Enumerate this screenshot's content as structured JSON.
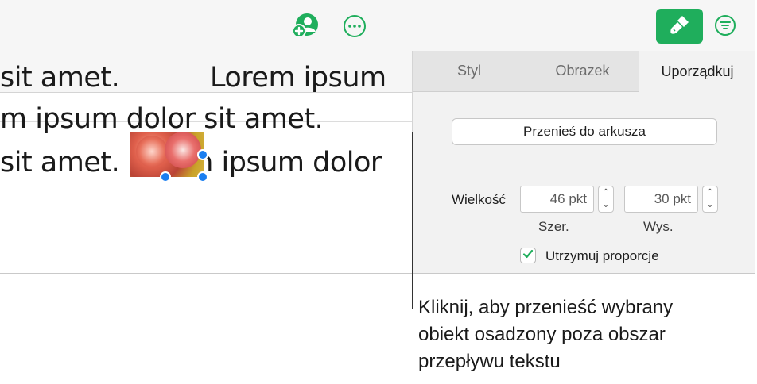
{
  "toolbar": {
    "collaborate_icon": "person-add-icon",
    "more_icon": "ellipsis-circle-icon",
    "format_icon": "paintbrush-icon",
    "organize_icon": "list-filter-icon",
    "accent_color": "#1fae5c"
  },
  "document": {
    "line1_before_image": "sit amet.",
    "line1_after_image": "Lorem ipsum",
    "line2": "m ipsum dolor sit amet.",
    "line3": "sit amet. Lorem ipsum dolor",
    "selection_handle_color": "#1a7ef0"
  },
  "sidebar": {
    "tabs": [
      {
        "label": "Styl",
        "active": false
      },
      {
        "label": "Obrazek",
        "active": false
      },
      {
        "label": "Uporządkuj",
        "active": true
      }
    ],
    "move_to_sheet_label": "Przenieś do arkusza",
    "size": {
      "label": "Wielkość",
      "width_value": "46 pkt",
      "height_value": "30 pkt",
      "width_caption": "Szer.",
      "height_caption": "Wys."
    },
    "keep_proportions": {
      "label": "Utrzymuj proporcje",
      "checked": true
    }
  },
  "callout": {
    "lines": [
      "Kliknij, aby przenieść wybrany",
      "obiekt osadzony poza obszar",
      "przepływu tekstu"
    ]
  }
}
